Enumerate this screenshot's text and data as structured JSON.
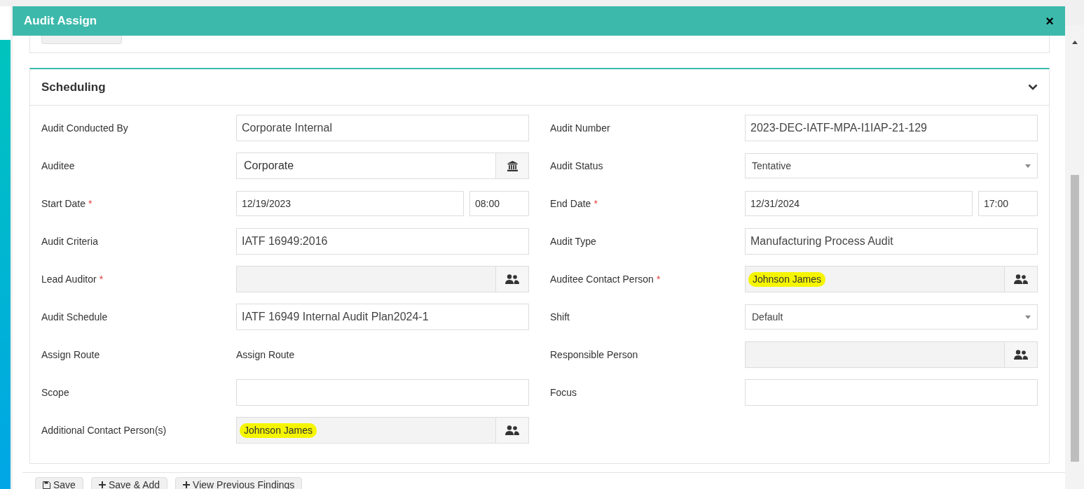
{
  "window": {
    "title": "Audit Assign",
    "close": "×"
  },
  "section": {
    "title": "Scheduling",
    "expanded": true
  },
  "rows": [
    {
      "left": {
        "label": "Audit Conducted By",
        "kind": "text",
        "value": "Corporate Internal",
        "disabled": false,
        "highlighted": false
      },
      "right": {
        "label": "Audit Number",
        "kind": "text",
        "value": "2023-DEC-IATF-MPA-I1IAP-21-129",
        "disabled": false,
        "highlighted": false
      }
    },
    {
      "left": {
        "label": "Auditee",
        "kind": "building-addon",
        "value": "Corporate",
        "disabled": false,
        "highlighted": false
      },
      "right": {
        "label": "Audit Status",
        "kind": "select",
        "value": "Tentative",
        "disabled": false,
        "highlighted": false
      }
    },
    {
      "left": {
        "label": "Start Date",
        "required_mark": "*",
        "kind": "datetime",
        "value": "12/19/2023",
        "time": "08:00",
        "disabled": false,
        "highlighted": false
      },
      "right": {
        "label": "End Date",
        "required_mark": "*",
        "kind": "datetime",
        "value": "12/31/2024",
        "time": "17:00",
        "disabled": false,
        "highlighted": false
      }
    },
    {
      "left": {
        "label": "Audit Criteria",
        "kind": "text",
        "value": "IATF 16949:2016",
        "disabled": false,
        "highlighted": false
      },
      "right": {
        "label": "Audit Type",
        "kind": "text",
        "value": "Manufacturing Process Audit",
        "disabled": false,
        "highlighted": false
      }
    },
    {
      "left": {
        "label": "Lead Auditor",
        "required_mark": "*",
        "kind": "people-addon",
        "disabled": true,
        "highlighted": false
      },
      "right": {
        "label": "Auditee Contact Person",
        "required_mark": "*",
        "kind": "people-addon",
        "value": "Johnson James",
        "disabled": true,
        "highlighted": true
      }
    },
    {
      "left": {
        "label": "Audit Schedule",
        "kind": "text",
        "value": "IATF 16949 Internal Audit Plan2024-1",
        "disabled": false,
        "highlighted": false
      },
      "right": {
        "label": "Shift",
        "kind": "select",
        "value": "Default",
        "disabled": false,
        "highlighted": false
      }
    },
    {
      "left": {
        "label": "Assign Route",
        "kind": "plain",
        "value": "Assign Route",
        "disabled": false,
        "highlighted": false
      },
      "right": {
        "label": "Responsible Person",
        "kind": "people-addon",
        "disabled": true,
        "highlighted": false
      }
    },
    {
      "left": {
        "label": "Scope",
        "kind": "text",
        "disabled": false,
        "highlighted": false
      },
      "right": {
        "label": "Focus",
        "kind": "text",
        "disabled": false,
        "highlighted": false
      }
    },
    {
      "left": {
        "label": "Additional Contact Person(s)",
        "kind": "people-addon",
        "value": "Johnson James",
        "disabled": true,
        "highlighted": true
      }
    }
  ],
  "buttons": [
    {
      "label": "Save",
      "kind": "save"
    },
    {
      "label": "Save & Add",
      "kind": "add"
    },
    {
      "label": "View Previous Findings",
      "kind": "add"
    }
  ]
}
